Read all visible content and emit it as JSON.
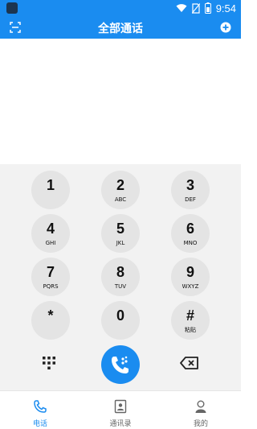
{
  "status_bar": {
    "time": "9:54"
  },
  "header": {
    "title": "全部通话"
  },
  "keypad": {
    "keys": [
      {
        "digit": "1",
        "sub": ""
      },
      {
        "digit": "2",
        "sub": "ABC"
      },
      {
        "digit": "3",
        "sub": "DEF"
      },
      {
        "digit": "4",
        "sub": "GHI"
      },
      {
        "digit": "5",
        "sub": "JKL"
      },
      {
        "digit": "6",
        "sub": "MNO"
      },
      {
        "digit": "7",
        "sub": "PQRS"
      },
      {
        "digit": "8",
        "sub": "TUV"
      },
      {
        "digit": "9",
        "sub": "WXYZ"
      },
      {
        "digit": "*",
        "sub": ""
      },
      {
        "digit": "0",
        "sub": ""
      },
      {
        "digit": "#",
        "sub": "粘贴"
      }
    ]
  },
  "tabs": [
    {
      "label": "电话",
      "icon": "phone-icon",
      "active": true
    },
    {
      "label": "通讯录",
      "icon": "contacts-icon",
      "active": false
    },
    {
      "label": "我的",
      "icon": "profile-icon",
      "active": false
    }
  ],
  "colors": {
    "accent": "#1a8cf0",
    "key_bg": "#e4e4e4",
    "keypad_bg": "#f2f2f2",
    "tab_inactive": "#666666"
  }
}
